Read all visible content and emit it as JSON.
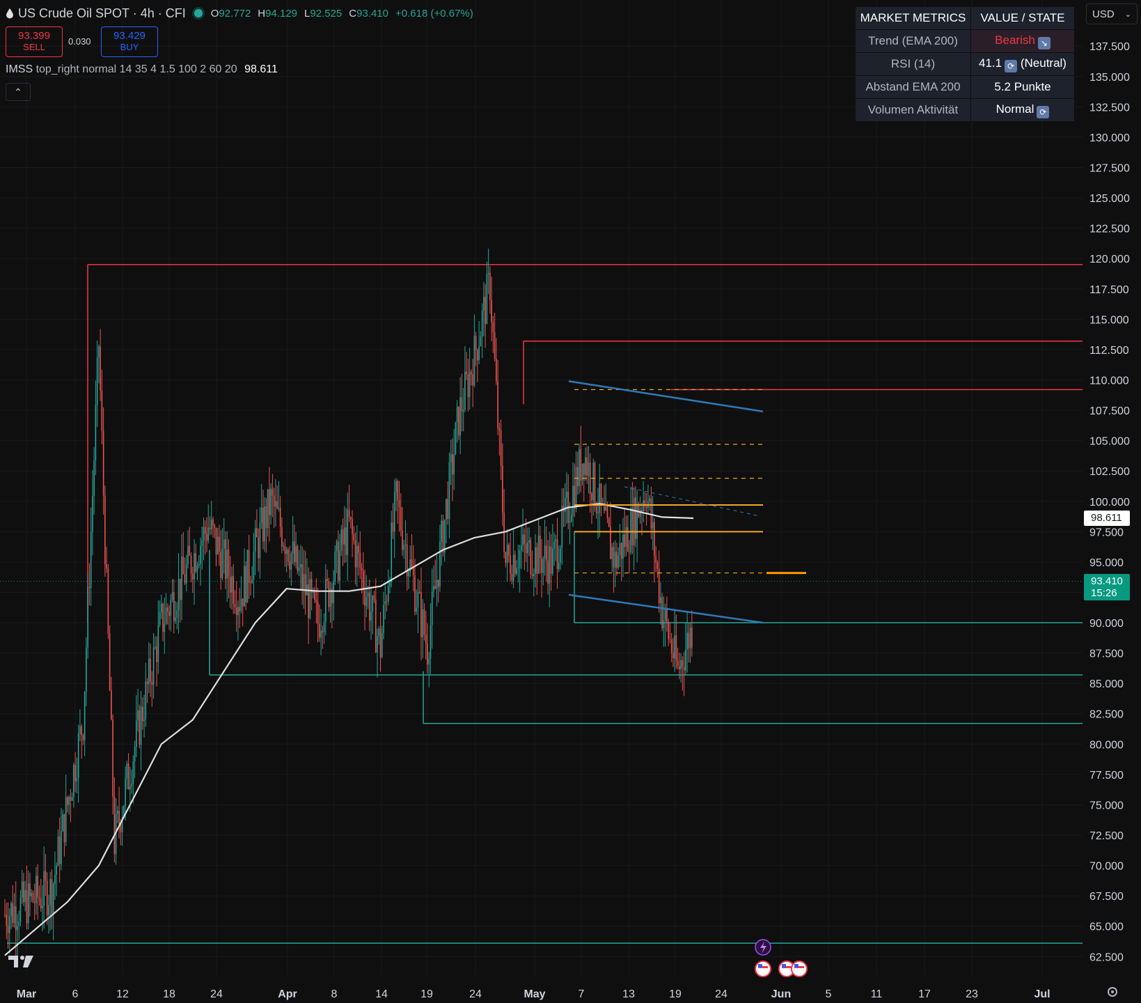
{
  "header": {
    "symbol": "US Crude Oil SPOT · 4h · CFI",
    "ohlc": [
      {
        "key": "O",
        "value": "92.772"
      },
      {
        "key": "H",
        "value": "94.129"
      },
      {
        "key": "L",
        "value": "92.525"
      },
      {
        "key": "C",
        "value": "93.410"
      }
    ],
    "change": "+0.618 (+0.67%)"
  },
  "trade": {
    "sell_price": "93.399",
    "sell_label": "SELL",
    "spread": "0.030",
    "buy_price": "93.429",
    "buy_label": "BUY"
  },
  "indicator": {
    "name": "IMSS",
    "params": "top_right normal 14 35 4 1.5 100 2 60 20",
    "value": "98.611"
  },
  "currency": {
    "selected": "USD"
  },
  "metrics": {
    "headers": [
      "MARKET METRICS",
      "VALUE / STATE"
    ],
    "rows": [
      {
        "label": "Trend (EMA 200)",
        "value": "Bearish",
        "icon": "chart-decreasing-icon"
      },
      {
        "label": "RSI (14)",
        "value_a": "41.1",
        "value_b": "(Neutral)",
        "icon": "cycle-arrows-icon"
      },
      {
        "label": "Abstand EMA 200",
        "value": "5.2 Punkte"
      },
      {
        "label": "Volumen Aktivität",
        "value": "Normal",
        "icon": "cycle-arrows-icon"
      }
    ]
  },
  "price_tags": {
    "ema": "98.611",
    "last_price": "93.410",
    "countdown": "15:26"
  },
  "colors": {
    "up": "#26a69a",
    "down": "#ef5350",
    "ema": "#e0e0e0",
    "resistance": "#f23645",
    "support": "#26a69a",
    "channel": "#2f7ab8",
    "fib": "#f5a623"
  },
  "chart_data": {
    "type": "candlestick",
    "y_ticks": [
      "137.500",
      "135.000",
      "132.500",
      "130.000",
      "127.500",
      "125.000",
      "122.500",
      "120.000",
      "117.500",
      "115.000",
      "112.500",
      "110.000",
      "107.500",
      "105.000",
      "102.500",
      "100.000",
      "97.500",
      "95.000",
      "92.500",
      "90.000",
      "87.500",
      "85.000",
      "82.500",
      "80.000",
      "77.500",
      "75.000",
      "72.500",
      "70.000",
      "67.500",
      "65.000",
      "62.500"
    ],
    "y_tick_values": [
      137.5,
      135,
      132.5,
      130,
      127.5,
      125,
      122.5,
      120,
      117.5,
      115,
      112.5,
      110,
      107.5,
      105,
      102.5,
      100,
      97.5,
      95,
      92.5,
      90,
      87.5,
      85,
      82.5,
      80,
      77.5,
      75,
      72.5,
      70,
      67.5,
      65,
      62.5
    ],
    "x_ticks": [
      "Mar",
      "6",
      "12",
      "18",
      "24",
      "Apr",
      "8",
      "14",
      "19",
      "24",
      "May",
      "7",
      "13",
      "19",
      "24",
      "Jun",
      "5",
      "11",
      "17",
      "23",
      "Jul"
    ],
    "ylim": [
      61.5,
      140
    ],
    "price_path": [
      [
        0,
        66
      ],
      [
        6,
        68
      ],
      [
        10,
        82
      ],
      [
        12,
        113
      ],
      [
        14,
        72
      ],
      [
        20,
        90
      ],
      [
        26,
        98
      ],
      [
        30,
        92
      ],
      [
        34,
        100
      ],
      [
        40,
        90
      ],
      [
        44,
        98
      ],
      [
        48,
        88
      ],
      [
        50,
        100
      ],
      [
        54,
        88
      ],
      [
        58,
        107
      ],
      [
        60,
        112
      ],
      [
        62,
        118
      ],
      [
        64,
        95
      ],
      [
        66,
        96
      ],
      [
        70,
        95
      ],
      [
        74,
        104
      ],
      [
        78,
        95
      ],
      [
        82,
        101
      ],
      [
        84,
        91
      ],
      [
        86,
        86
      ],
      [
        88,
        90
      ],
      [
        92,
        90
      ],
      [
        94,
        100
      ],
      [
        98,
        105
      ],
      [
        100,
        110
      ],
      [
        104,
        106
      ],
      [
        108,
        100
      ],
      [
        112,
        97
      ],
      [
        116,
        102
      ],
      [
        120,
        98
      ],
      [
        124,
        103
      ],
      [
        128,
        108
      ],
      [
        130,
        106
      ],
      [
        134,
        102
      ],
      [
        136,
        97
      ],
      [
        138,
        95
      ],
      [
        140,
        91
      ],
      [
        142,
        97
      ],
      [
        143.5,
        93.41
      ]
    ],
    "ema_values": [
      [
        0,
        62.6
      ],
      [
        8,
        67
      ],
      [
        12,
        70
      ],
      [
        16,
        75
      ],
      [
        20,
        80
      ],
      [
        24,
        82
      ],
      [
        28,
        86
      ],
      [
        32,
        90
      ],
      [
        36,
        92.8
      ],
      [
        40,
        92.6
      ],
      [
        44,
        92.6
      ],
      [
        48,
        93
      ],
      [
        52,
        94.5
      ],
      [
        56,
        96
      ],
      [
        60,
        97
      ],
      [
        64,
        97.5
      ],
      [
        68,
        98.5
      ],
      [
        72,
        99.5
      ],
      [
        76,
        99.8
      ],
      [
        80,
        99.3
      ],
      [
        84,
        98.7
      ],
      [
        88,
        98.611
      ]
    ],
    "horizontal_levels": [
      {
        "price": 119.5,
        "kind": "resistance"
      },
      {
        "price": 113.2,
        "kind": "resistance"
      },
      {
        "price": 109.2,
        "kind": "resistance"
      },
      {
        "price": 90.0,
        "kind": "support"
      },
      {
        "price": 85.7,
        "kind": "support"
      },
      {
        "price": 81.7,
        "kind": "support"
      },
      {
        "price": 63.6,
        "kind": "support"
      }
    ],
    "fib_levels": [
      {
        "price": 109.2,
        "style": "dashed"
      },
      {
        "price": 104.7,
        "style": "dashed"
      },
      {
        "price": 101.9,
        "style": "dashed"
      },
      {
        "price": 99.7,
        "style": "solid"
      },
      {
        "price": 97.5,
        "style": "solid"
      },
      {
        "price": 94.1,
        "style": "dashed"
      }
    ],
    "channel": [
      {
        "from": [
          3,
          109.9
        ],
        "to": [
          7.5,
          107.4
        ]
      },
      {
        "from": [
          3,
          92.3
        ],
        "to": [
          7.5,
          90.0
        ]
      }
    ]
  }
}
